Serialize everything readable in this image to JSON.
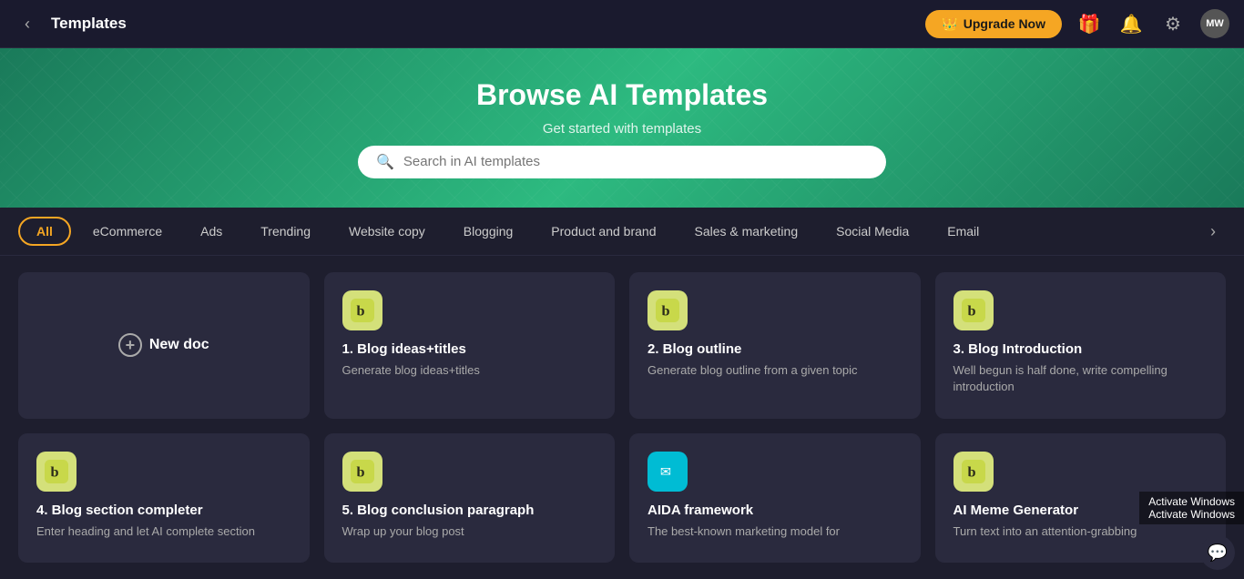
{
  "topbar": {
    "back_icon": "‹",
    "title": "Templates",
    "upgrade_label": "Upgrade Now",
    "crown_icon": "👑",
    "gift_icon": "🎁",
    "bell_icon": "🔔",
    "gear_icon": "⚙",
    "avatar_label": "MW"
  },
  "hero": {
    "title": "Browse AI Templates",
    "subtitle": "Get started with templates",
    "search_placeholder": "Search in AI templates"
  },
  "filter_tabs": [
    {
      "label": "All",
      "active": true
    },
    {
      "label": "eCommerce",
      "active": false
    },
    {
      "label": "Ads",
      "active": false
    },
    {
      "label": "Trending",
      "active": false
    },
    {
      "label": "Website copy",
      "active": false
    },
    {
      "label": "Blogging",
      "active": false
    },
    {
      "label": "Product and brand",
      "active": false
    },
    {
      "label": "Sales & marketing",
      "active": false
    },
    {
      "label": "Social Media",
      "active": false
    },
    {
      "label": "Email",
      "active": false
    }
  ],
  "new_doc": {
    "label": "New doc"
  },
  "cards": [
    {
      "id": 1,
      "title": "1. Blog ideas+titles",
      "description": "Generate blog ideas+titles",
      "icon_type": "yellow",
      "icon": "ᵬ"
    },
    {
      "id": 2,
      "title": "2. Blog outline",
      "description": "Generate blog outline from a given topic",
      "icon_type": "yellow",
      "icon": "ᵬ"
    },
    {
      "id": 3,
      "title": "3. Blog Introduction",
      "description": "Well begun is half done, write compelling introduction",
      "icon_type": "yellow",
      "icon": "ᵬ"
    },
    {
      "id": 4,
      "title": "4. Blog section completer",
      "description": "Enter heading and let AI complete section",
      "icon_type": "yellow",
      "icon": "ᵬ"
    },
    {
      "id": 5,
      "title": "5. Blog conclusion paragraph",
      "description": "Wrap up your blog post",
      "icon_type": "yellow",
      "icon": "ᵬ"
    },
    {
      "id": 6,
      "title": "AIDA framework",
      "description": "The best-known marketing model for",
      "icon_type": "cyan",
      "icon": "✉"
    },
    {
      "id": 7,
      "title": "AI Meme Generator",
      "description": "Turn text into an attention-grabbing",
      "icon_type": "yellow",
      "icon": "ᵬ"
    }
  ],
  "windows_watermark": "Activate Windows\nActivate Windows",
  "chat_icon": "💬"
}
